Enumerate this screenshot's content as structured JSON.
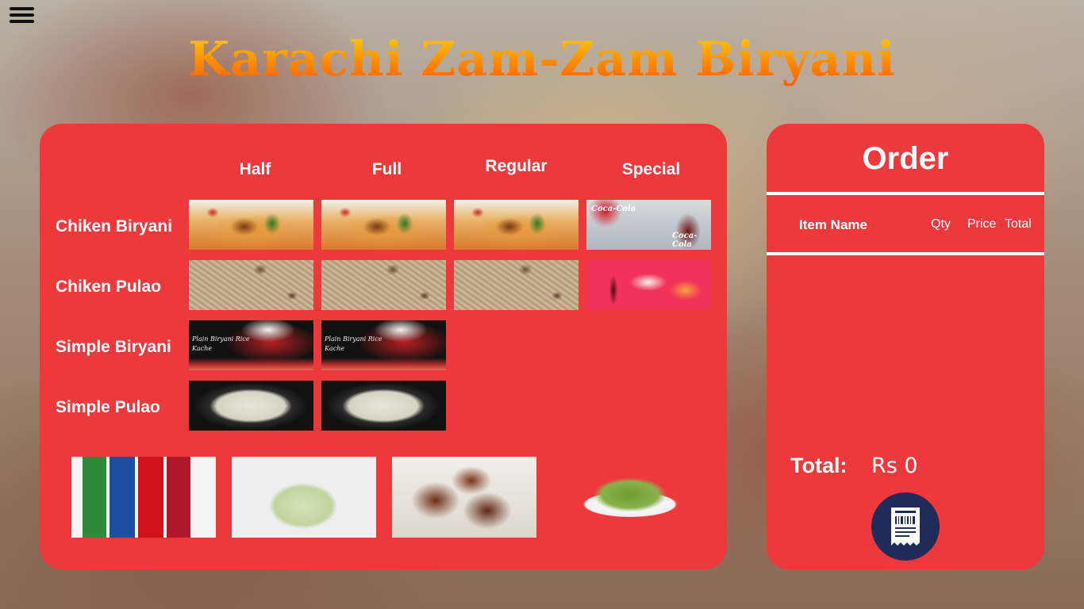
{
  "app": {
    "title": "Karachi Zam-Zam Biryani"
  },
  "menu": {
    "columns": [
      "Half",
      "Full",
      "Regular",
      "Special"
    ],
    "rows": [
      {
        "label": "Chiken Biryani"
      },
      {
        "label": "Chiken Pulao"
      },
      {
        "label": "Simple Biryani"
      },
      {
        "label": "Simple Pulao"
      }
    ],
    "image_text": {
      "simple_biryani": "Plain Biryani Rice\nKache",
      "coca_cola": "Coca-Cola"
    },
    "extras": [
      "soft-drinks",
      "raita",
      "shami-kabab",
      "salad"
    ]
  },
  "order": {
    "title": "Order",
    "headers": {
      "item_name": "Item Name",
      "qty": "Qty",
      "price": "Price",
      "total": "Total"
    },
    "items": [],
    "total_label": "Total:",
    "total_value": "Rs 0"
  },
  "colors": {
    "panel": "#ee393c",
    "receipt_button": "#1f2c59",
    "title_gradient": [
      "#ffd400",
      "#ff5a00"
    ]
  }
}
